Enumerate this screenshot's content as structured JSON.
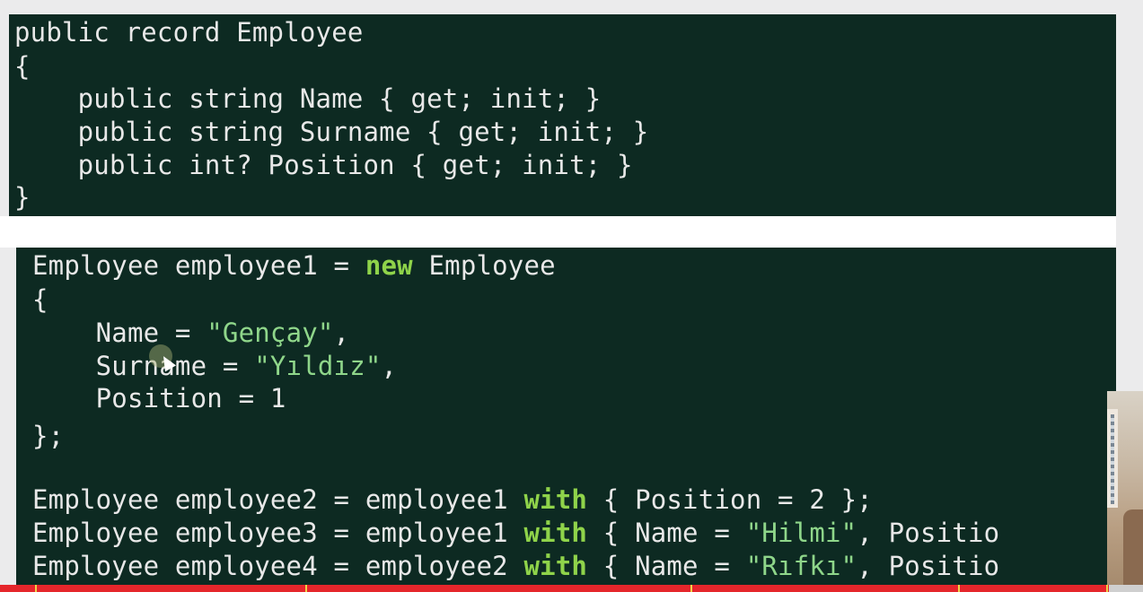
{
  "record_block": {
    "line1": "public record Employee",
    "line2": "{",
    "line3": "    public string Name { get; init; }",
    "line4": "    public string Surname { get; init; }",
    "line5": "    public int? Position { get; init; }",
    "line6": "}"
  },
  "usage_block": {
    "line1_a": "Employee employee1 = ",
    "line1_kw": "new",
    "line1_b": " Employee",
    "line2": "{",
    "line3_a": "    Name = ",
    "line3_str": "\"Gençay\"",
    "line3_b": ",",
    "line4_a": "    Surname = ",
    "line4_str": "\"Yıldız\"",
    "line4_b": ",",
    "line5": "    Position = 1",
    "line6": "};",
    "line7_a": "Employee employee2 = employee1 ",
    "line7_kw": "with",
    "line7_b": " { Position = 2 };",
    "line8_a": "Employee employee3 = employee1 ",
    "line8_kw": "with",
    "line8_b": " { Name = ",
    "line8_str": "\"Hilmi\"",
    "line8_c": ", Positio",
    "line9_a": "Employee employee4 = employee2 ",
    "line9_kw": "with",
    "line9_b": " { Name = ",
    "line9_str": "\"Rıfkı\"",
    "line9_c": ", Positio"
  },
  "video": {
    "progress": 0.97,
    "accent_color": "#e5262b",
    "chapter_markers": [
      0.031,
      0.267,
      0.604,
      0.838,
      0.968
    ]
  },
  "colors": {
    "background": "#0d2a22",
    "keyword": "#8fd34a",
    "string": "#8fd68a",
    "text": "#e8e8e8"
  }
}
